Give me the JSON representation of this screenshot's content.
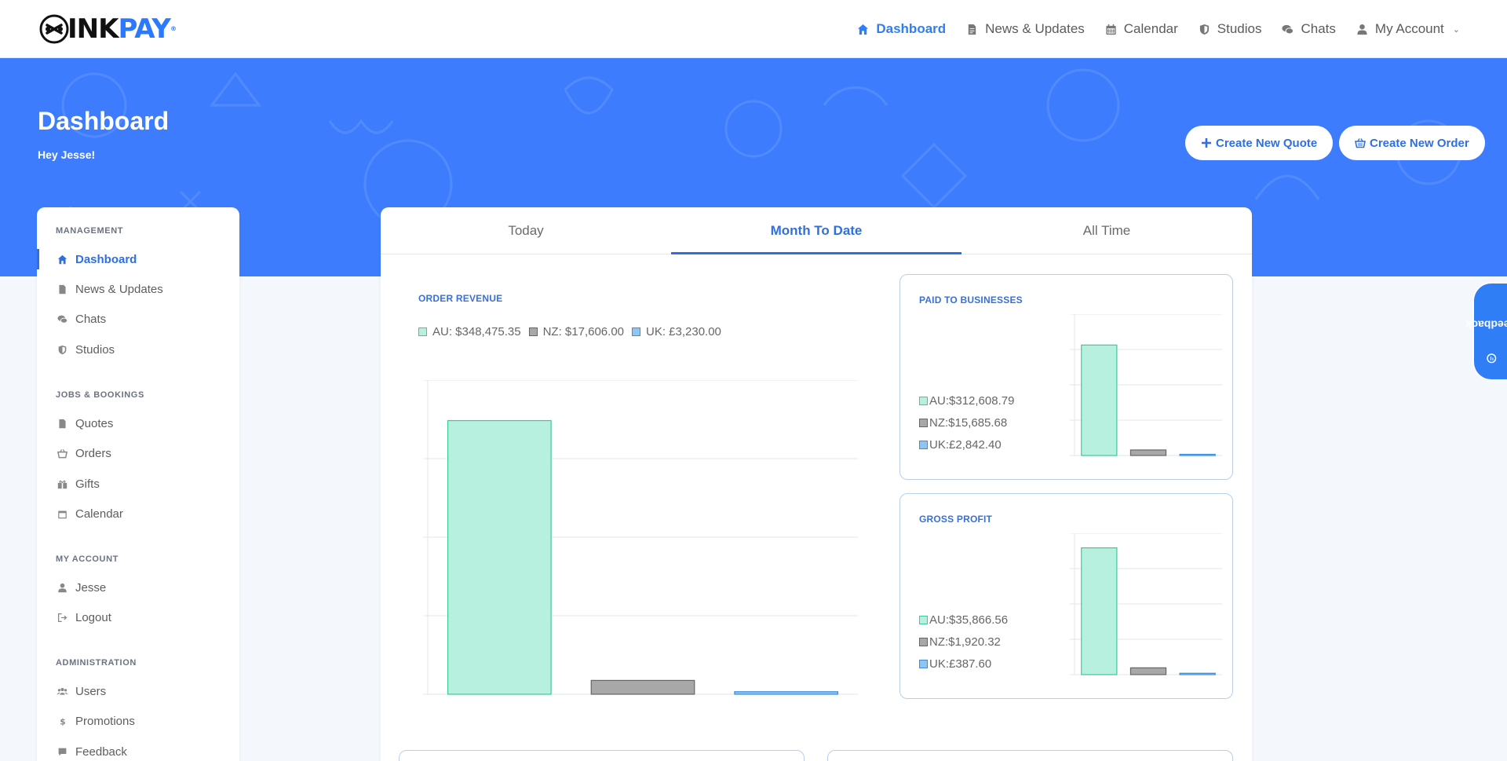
{
  "brand": {
    "ink": "INK",
    "pay": "PAY",
    "tm": "®"
  },
  "nav": {
    "items": [
      {
        "label": "Dashboard",
        "icon": "home-icon",
        "active": true
      },
      {
        "label": "News & Updates",
        "icon": "document-icon"
      },
      {
        "label": "Calendar",
        "icon": "calendar-icon"
      },
      {
        "label": "Studios",
        "icon": "shield-icon"
      },
      {
        "label": "Chats",
        "icon": "chat-bubbles-icon"
      },
      {
        "label": "My Account",
        "icon": "user-icon"
      }
    ]
  },
  "hero": {
    "title": "Dashboard",
    "subtitle": "Hey Jesse!",
    "create_quote": "Create New Quote",
    "create_order": "Create New Order"
  },
  "sidebar": {
    "sections": [
      {
        "title": "MANAGEMENT",
        "items": [
          {
            "label": "Dashboard",
            "icon": "home-icon",
            "active": true
          },
          {
            "label": "News & Updates",
            "icon": "document-icon"
          },
          {
            "label": "Chats",
            "icon": "chat-bubbles-icon"
          },
          {
            "label": "Studios",
            "icon": "shield-icon"
          }
        ]
      },
      {
        "title": "JOBS & BOOKINGS",
        "items": [
          {
            "label": "Quotes",
            "icon": "document-icon"
          },
          {
            "label": "Orders",
            "icon": "basket-icon"
          },
          {
            "label": "Gifts",
            "icon": "gift-icon"
          },
          {
            "label": "Calendar",
            "icon": "calendar-icon"
          }
        ]
      },
      {
        "title": "MY ACCOUNT",
        "items": [
          {
            "label": "Jesse",
            "icon": "user-icon"
          },
          {
            "label": "Logout",
            "icon": "logout-icon"
          }
        ]
      },
      {
        "title": "ADMINISTRATION",
        "items": [
          {
            "label": "Users",
            "icon": "users-icon"
          },
          {
            "label": "Promotions",
            "icon": "dollar-icon"
          },
          {
            "label": "Feedback",
            "icon": "comment-icon"
          }
        ]
      }
    ]
  },
  "tabs": [
    {
      "label": "Today"
    },
    {
      "label": "Month To Date",
      "active": true
    },
    {
      "label": "All Time"
    }
  ],
  "colors": {
    "au": "#b8f0e0",
    "au_border": "#3dc99b",
    "nz": "#a8a8a8",
    "nz_border": "#666666",
    "uk": "#8ec5f2",
    "uk_border": "#3b8edb",
    "accent": "#2f6fe0",
    "hero": "#3d7dfd"
  },
  "order_revenue": {
    "title": "ORDER REVENUE",
    "legend": [
      "AU: $348,475.35",
      "NZ: $17,606.00",
      "UK: £3,230.00"
    ]
  },
  "paid_to_businesses": {
    "title": "PAID TO BUSINESSES",
    "legend": [
      "AU:$312,608.79",
      "NZ:$15,685.68",
      "UK:£2,842.40"
    ]
  },
  "gross_profit": {
    "title": "GROSS PROFIT",
    "legend": [
      "AU:$35,866.56",
      "NZ:$1,920.32",
      "UK:£387.60"
    ]
  },
  "chart_data": [
    {
      "type": "bar",
      "title": "ORDER REVENUE",
      "categories": [
        "AU",
        "NZ",
        "UK"
      ],
      "values": [
        348475.35,
        17606.0,
        3230.0
      ],
      "ylim": [
        0,
        400000
      ],
      "grid": true,
      "legend": "top-left"
    },
    {
      "type": "bar",
      "title": "PAID TO BUSINESSES",
      "categories": [
        "AU",
        "NZ",
        "UK"
      ],
      "values": [
        312608.79,
        15685.68,
        2842.4
      ],
      "ylim": [
        0,
        400000
      ],
      "grid": true,
      "legend": "left"
    },
    {
      "type": "bar",
      "title": "GROSS PROFIT",
      "categories": [
        "AU",
        "NZ",
        "UK"
      ],
      "values": [
        35866.56,
        1920.32,
        387.6
      ],
      "ylim": [
        0,
        40000
      ],
      "grid": true,
      "legend": "left"
    }
  ],
  "feedback_tab": "Feedback"
}
